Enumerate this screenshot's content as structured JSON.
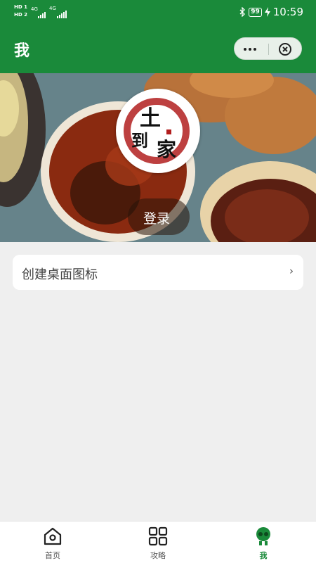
{
  "status_bar": {
    "sim1": "HD 1",
    "sim2": "HD 2",
    "net1": "4G",
    "net2": "4G",
    "battery": "99",
    "time": "10:59"
  },
  "nav": {
    "title": "我"
  },
  "profile": {
    "login_label": "登录",
    "logo_text": "土到家"
  },
  "menu": {
    "create_shortcut_label": "创建桌面图标",
    "chevron": "›"
  },
  "tabbar": {
    "tabs": [
      {
        "label": "首页",
        "icon": "home-icon",
        "active": false
      },
      {
        "label": "攻略",
        "icon": "grid-icon",
        "active": false
      },
      {
        "label": "我",
        "icon": "profile-icon",
        "active": true
      }
    ]
  },
  "colors": {
    "brand_green": "#1a8a3a",
    "page_bg": "#efefef"
  }
}
